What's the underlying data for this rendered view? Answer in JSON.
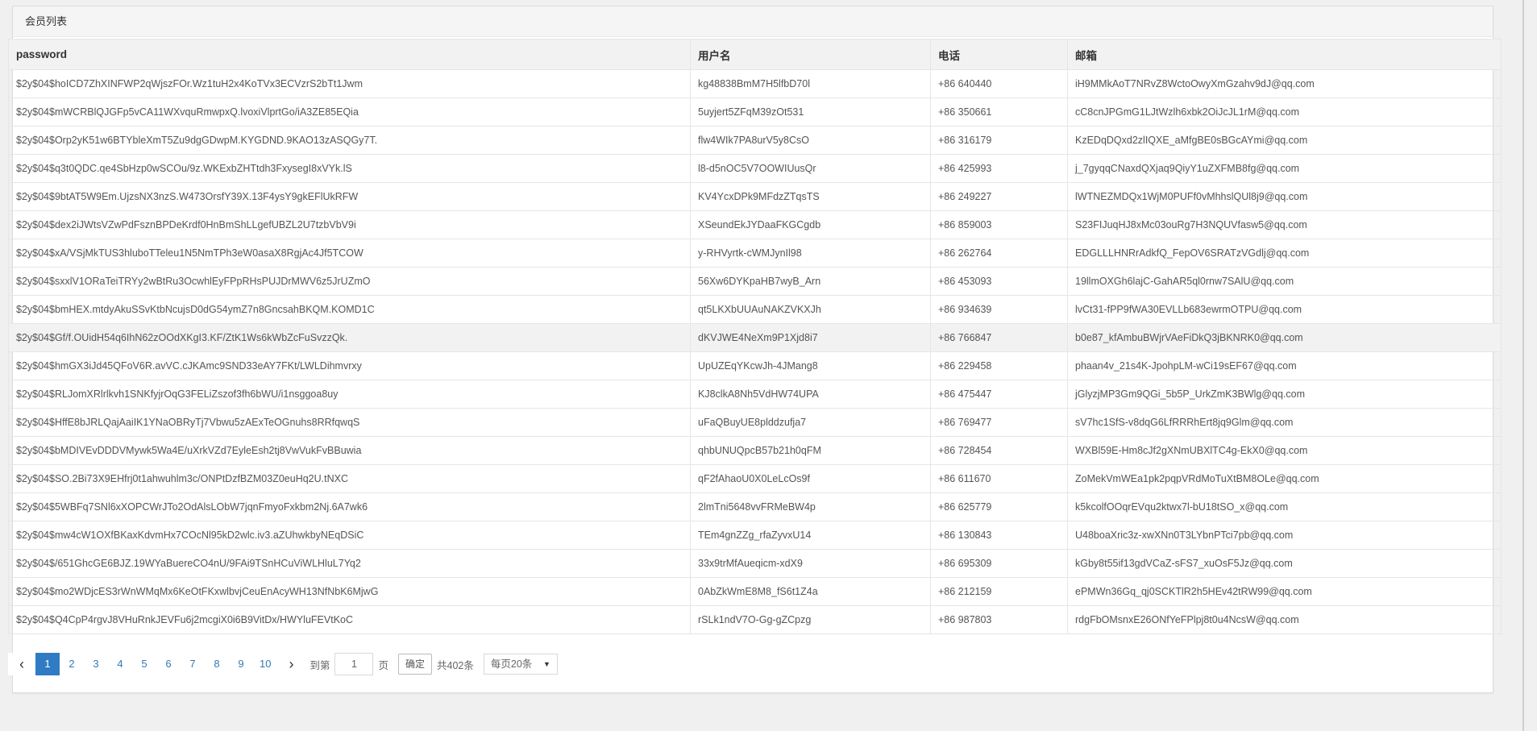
{
  "panel": {
    "title": "会员列表"
  },
  "table": {
    "headers": [
      "password",
      "用户名",
      "电话",
      "邮箱"
    ],
    "rows": [
      [
        "$2y$04$hoICD7ZhXINFWP2qWjszFOr.Wz1tuH2x4KoTVx3ECVzrS2bTt1Jwm",
        "kg48838BmM7H5lfbD70l",
        "+86 640440",
        "iH9MMkAoT7NRvZ8WctoOwyXmGzahv9dJ@qq.com"
      ],
      [
        "$2y$04$mWCRBlQJGFp5vCA11WXvquRmwpxQ.lvoxiVlprtGo/iA3ZE85EQia",
        "5uyjert5ZFqM39zOt531",
        "+86 350661",
        "cC8cnJPGmG1LJtWzlh6xbk2OiJcJL1rM@qq.com"
      ],
      [
        "$2y$04$Orp2yK51w6BTYbleXmT5Zu9dgGDwpM.KYGDND.9KAO13zASQGy7T.",
        "flw4WIk7PA8urV5y8CsO",
        "+86 316179",
        "KzEDqDQxd2zlIQXE_aMfgBE0sBGcAYmi@qq.com"
      ],
      [
        "$2y$04$q3t0QDC.qe4SbHzp0wSCOu/9z.WKExbZHTtdh3FxysegI8xVYk.lS",
        "l8-d5nOC5V7OOWIUusQr",
        "+86 425993",
        "j_7gyqqCNaxdQXjaq9QiyY1uZXFMB8fg@qq.com"
      ],
      [
        "$2y$04$9btAT5W9Em.UjzsNX3nzS.W473OrsfY39X.13F4ysY9gkEFlUkRFW",
        "KV4YcxDPk9MFdzZTqsTS",
        "+86 249227",
        "lWTNEZMDQx1WjM0PUFf0vMhhslQUl8j9@qq.com"
      ],
      [
        "$2y$04$dex2iJWtsVZwPdFsznBPDeKrdf0HnBmShLLgefUBZL2U7tzbVbV9i",
        "XSeundEkJYDaaFKGCgdb",
        "+86 859003",
        "S23FIJuqHJ8xMc03ouRg7H3NQUVfasw5@qq.com"
      ],
      [
        "$2y$04$xA/VSjMkTUS3hluboTTeleu1N5NmTPh3eW0asaX8RgjAc4Jf5TCOW",
        "y-RHVyrtk-cWMJynIl98",
        "+86 262764",
        "EDGLLLHNRrAdkfQ_FepOV6SRATzVGdlj@qq.com"
      ],
      [
        "$2y$04$sxxlV1ORaTeiTRYy2wBtRu3OcwhlEyFPpRHsPUJDrMWV6z5JrUZmO",
        "56Xw6DYKpaHB7wyB_Arn",
        "+86 453093",
        "19llmOXGh6lajC-GahAR5ql0rnw7SAlU@qq.com"
      ],
      [
        "$2y$04$bmHEX.mtdyAkuSSvKtbNcujsD0dG54ymZ7n8GncsahBKQM.KOMD1C",
        "qt5LKXbUUAuNAKZVKXJh",
        "+86 934639",
        "lvCt31-fPP9fWA30EVLLb683ewrmOTPU@qq.com"
      ],
      [
        "$2y$04$Gf/f.OUidH54q6IhN62zOOdXKgI3.KF/ZtK1Ws6kWbZcFuSvzzQk.",
        "dKVJWE4NeXm9P1Xjd8i7",
        "+86 766847",
        "b0e87_kfAmbuBWjrVAeFiDkQ3jBKNRK0@qq.com"
      ],
      [
        "$2y$04$hmGX3iJd45QFoV6R.avVC.cJKAmc9SND33eAY7FKt/LWLDihmvrxy",
        "UpUZEqYKcwJh-4JMang8",
        "+86 229458",
        "phaan4v_21s4K-JpohpLM-wCi19sEF67@qq.com"
      ],
      [
        "$2y$04$RLJomXRlrlkvh1SNKfyjrOqG3FELiZszof3fh6bWU/i1nsggoa8uy",
        "KJ8clkA8Nh5VdHW74UPA",
        "+86 475447",
        "jGlyzjMP3Gm9QGi_5b5P_UrkZmK3BWlg@qq.com"
      ],
      [
        "$2y$04$HffE8bJRLQajAaiIK1YNaOBRyTj7Vbwu5zAExTeOGnuhs8RRfqwqS",
        "uFaQBuyUE8plddzufja7",
        "+86 769477",
        "sV7hc1SfS-v8dqG6LfRRRhErt8jq9Glm@qq.com"
      ],
      [
        "$2y$04$bMDIVEvDDDVMywk5Wa4E/uXrkVZd7EyleEsh2tj8VwVukFvBBuwia",
        "qhbUNUQpcB57b21h0qFM",
        "+86 728454",
        "WXBl59E-Hm8cJf2gXNmUBXlTC4g-EkX0@qq.com"
      ],
      [
        "$2y$04$SO.2Bi73X9EHfrj0t1ahwuhlm3c/ONPtDzfBZM03Z0euHq2U.tNXC",
        "qF2fAhaoU0X0LeLcOs9f",
        "+86 611670",
        "ZoMekVmWEa1pk2pqpVRdMoTuXtBM8OLe@qq.com"
      ],
      [
        "$2y$04$5WBFq7SNl6xXOPCWrJTo2OdAlsLObW7jqnFmyoFxkbm2Nj.6A7wk6",
        "2lmTni5648vvFRMeBW4p",
        "+86 625779",
        "k5kcolfOOqrEVqu2ktwx7l-bU18tSO_x@qq.com"
      ],
      [
        "$2y$04$mw4cW1OXfBKaxKdvmHx7COcNl95kD2wlc.iv3.aZUhwkbyNEqDSiC",
        "TEm4gnZZg_rfaZyvxU14",
        "+86 130843",
        "U48boaXric3z-xwXNn0T3LYbnPTci7pb@qq.com"
      ],
      [
        "$2y$04$/651GhcGE6BJZ.19WYaBuereCO4nU/9FAi9TSnHCuViWLHluL7Yq2",
        "33x9trMfAueqicm-xdX9",
        "+86 695309",
        "kGby8t55if13gdVCaZ-sFS7_xuOsF5Jz@qq.com"
      ],
      [
        "$2y$04$mo2WDjcES3rWnWMqMx6KeOtFKxwlbvjCeuEnAcyWH13NfNbK6MjwG",
        "0AbZkWmE8M8_fS6t1Z4a",
        "+86 212159",
        "ePMWn36Gq_qj0SCKTlR2h5HEv42tRW99@qq.com"
      ],
      [
        "$2y$04$Q4CpP4rgvJ8VHuRnkJEVFu6j2mcgiX0i6B9VitDx/HWYluFEVtKoC",
        "rSLk1ndV7O-Gg-gZCpzg",
        "+86 987803",
        "rdgFbOMsnxE26ONfYeFPlpj8t0u4NcsW@qq.com"
      ]
    ]
  },
  "pagination": {
    "pages": [
      "1",
      "2",
      "3",
      "4",
      "5",
      "6",
      "7",
      "8",
      "9",
      "10"
    ],
    "current": "1",
    "goto_label": "到第",
    "goto_value": "1",
    "page_label": "页",
    "confirm_label": "确定",
    "total_label": "共402条",
    "per_page_label": "每页20条"
  }
}
